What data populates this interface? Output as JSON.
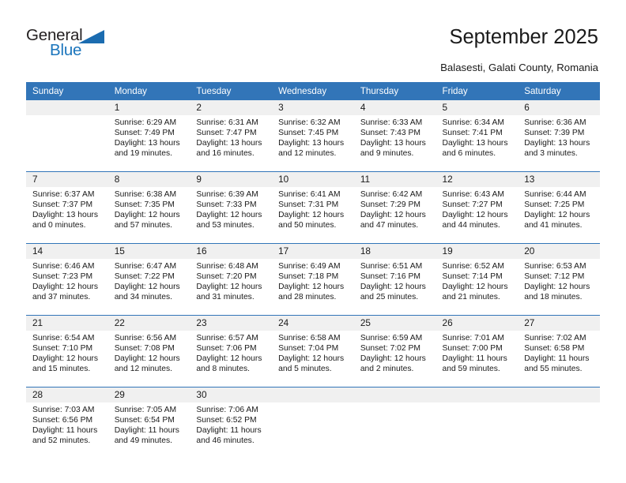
{
  "logo": {
    "word_one": "General",
    "word_two": "Blue",
    "triangle_color": "#1b6cb0",
    "blue_text_color": "#1b75bc"
  },
  "header": {
    "title": "September 2025",
    "subtitle": "Balasesti, Galati County, Romania",
    "accent_color": "#3275b8",
    "band_color": "#f0f0f0"
  },
  "calendar": {
    "weekday_headers": [
      "Sunday",
      "Monday",
      "Tuesday",
      "Wednesday",
      "Thursday",
      "Friday",
      "Saturday"
    ],
    "weeks": [
      [
        {
          "day": "",
          "sunrise": "",
          "sunset": "",
          "daylight_line1": "",
          "daylight_line2": ""
        },
        {
          "day": "1",
          "sunrise": "Sunrise: 6:29 AM",
          "sunset": "Sunset: 7:49 PM",
          "daylight_line1": "Daylight: 13 hours",
          "daylight_line2": "and 19 minutes."
        },
        {
          "day": "2",
          "sunrise": "Sunrise: 6:31 AM",
          "sunset": "Sunset: 7:47 PM",
          "daylight_line1": "Daylight: 13 hours",
          "daylight_line2": "and 16 minutes."
        },
        {
          "day": "3",
          "sunrise": "Sunrise: 6:32 AM",
          "sunset": "Sunset: 7:45 PM",
          "daylight_line1": "Daylight: 13 hours",
          "daylight_line2": "and 12 minutes."
        },
        {
          "day": "4",
          "sunrise": "Sunrise: 6:33 AM",
          "sunset": "Sunset: 7:43 PM",
          "daylight_line1": "Daylight: 13 hours",
          "daylight_line2": "and 9 minutes."
        },
        {
          "day": "5",
          "sunrise": "Sunrise: 6:34 AM",
          "sunset": "Sunset: 7:41 PM",
          "daylight_line1": "Daylight: 13 hours",
          "daylight_line2": "and 6 minutes."
        },
        {
          "day": "6",
          "sunrise": "Sunrise: 6:36 AM",
          "sunset": "Sunset: 7:39 PM",
          "daylight_line1": "Daylight: 13 hours",
          "daylight_line2": "and 3 minutes."
        }
      ],
      [
        {
          "day": "7",
          "sunrise": "Sunrise: 6:37 AM",
          "sunset": "Sunset: 7:37 PM",
          "daylight_line1": "Daylight: 13 hours",
          "daylight_line2": "and 0 minutes."
        },
        {
          "day": "8",
          "sunrise": "Sunrise: 6:38 AM",
          "sunset": "Sunset: 7:35 PM",
          "daylight_line1": "Daylight: 12 hours",
          "daylight_line2": "and 57 minutes."
        },
        {
          "day": "9",
          "sunrise": "Sunrise: 6:39 AM",
          "sunset": "Sunset: 7:33 PM",
          "daylight_line1": "Daylight: 12 hours",
          "daylight_line2": "and 53 minutes."
        },
        {
          "day": "10",
          "sunrise": "Sunrise: 6:41 AM",
          "sunset": "Sunset: 7:31 PM",
          "daylight_line1": "Daylight: 12 hours",
          "daylight_line2": "and 50 minutes."
        },
        {
          "day": "11",
          "sunrise": "Sunrise: 6:42 AM",
          "sunset": "Sunset: 7:29 PM",
          "daylight_line1": "Daylight: 12 hours",
          "daylight_line2": "and 47 minutes."
        },
        {
          "day": "12",
          "sunrise": "Sunrise: 6:43 AM",
          "sunset": "Sunset: 7:27 PM",
          "daylight_line1": "Daylight: 12 hours",
          "daylight_line2": "and 44 minutes."
        },
        {
          "day": "13",
          "sunrise": "Sunrise: 6:44 AM",
          "sunset": "Sunset: 7:25 PM",
          "daylight_line1": "Daylight: 12 hours",
          "daylight_line2": "and 41 minutes."
        }
      ],
      [
        {
          "day": "14",
          "sunrise": "Sunrise: 6:46 AM",
          "sunset": "Sunset: 7:23 PM",
          "daylight_line1": "Daylight: 12 hours",
          "daylight_line2": "and 37 minutes."
        },
        {
          "day": "15",
          "sunrise": "Sunrise: 6:47 AM",
          "sunset": "Sunset: 7:22 PM",
          "daylight_line1": "Daylight: 12 hours",
          "daylight_line2": "and 34 minutes."
        },
        {
          "day": "16",
          "sunrise": "Sunrise: 6:48 AM",
          "sunset": "Sunset: 7:20 PM",
          "daylight_line1": "Daylight: 12 hours",
          "daylight_line2": "and 31 minutes."
        },
        {
          "day": "17",
          "sunrise": "Sunrise: 6:49 AM",
          "sunset": "Sunset: 7:18 PM",
          "daylight_line1": "Daylight: 12 hours",
          "daylight_line2": "and 28 minutes."
        },
        {
          "day": "18",
          "sunrise": "Sunrise: 6:51 AM",
          "sunset": "Sunset: 7:16 PM",
          "daylight_line1": "Daylight: 12 hours",
          "daylight_line2": "and 25 minutes."
        },
        {
          "day": "19",
          "sunrise": "Sunrise: 6:52 AM",
          "sunset": "Sunset: 7:14 PM",
          "daylight_line1": "Daylight: 12 hours",
          "daylight_line2": "and 21 minutes."
        },
        {
          "day": "20",
          "sunrise": "Sunrise: 6:53 AM",
          "sunset": "Sunset: 7:12 PM",
          "daylight_line1": "Daylight: 12 hours",
          "daylight_line2": "and 18 minutes."
        }
      ],
      [
        {
          "day": "21",
          "sunrise": "Sunrise: 6:54 AM",
          "sunset": "Sunset: 7:10 PM",
          "daylight_line1": "Daylight: 12 hours",
          "daylight_line2": "and 15 minutes."
        },
        {
          "day": "22",
          "sunrise": "Sunrise: 6:56 AM",
          "sunset": "Sunset: 7:08 PM",
          "daylight_line1": "Daylight: 12 hours",
          "daylight_line2": "and 12 minutes."
        },
        {
          "day": "23",
          "sunrise": "Sunrise: 6:57 AM",
          "sunset": "Sunset: 7:06 PM",
          "daylight_line1": "Daylight: 12 hours",
          "daylight_line2": "and 8 minutes."
        },
        {
          "day": "24",
          "sunrise": "Sunrise: 6:58 AM",
          "sunset": "Sunset: 7:04 PM",
          "daylight_line1": "Daylight: 12 hours",
          "daylight_line2": "and 5 minutes."
        },
        {
          "day": "25",
          "sunrise": "Sunrise: 6:59 AM",
          "sunset": "Sunset: 7:02 PM",
          "daylight_line1": "Daylight: 12 hours",
          "daylight_line2": "and 2 minutes."
        },
        {
          "day": "26",
          "sunrise": "Sunrise: 7:01 AM",
          "sunset": "Sunset: 7:00 PM",
          "daylight_line1": "Daylight: 11 hours",
          "daylight_line2": "and 59 minutes."
        },
        {
          "day": "27",
          "sunrise": "Sunrise: 7:02 AM",
          "sunset": "Sunset: 6:58 PM",
          "daylight_line1": "Daylight: 11 hours",
          "daylight_line2": "and 55 minutes."
        }
      ],
      [
        {
          "day": "28",
          "sunrise": "Sunrise: 7:03 AM",
          "sunset": "Sunset: 6:56 PM",
          "daylight_line1": "Daylight: 11 hours",
          "daylight_line2": "and 52 minutes."
        },
        {
          "day": "29",
          "sunrise": "Sunrise: 7:05 AM",
          "sunset": "Sunset: 6:54 PM",
          "daylight_line1": "Daylight: 11 hours",
          "daylight_line2": "and 49 minutes."
        },
        {
          "day": "30",
          "sunrise": "Sunrise: 7:06 AM",
          "sunset": "Sunset: 6:52 PM",
          "daylight_line1": "Daylight: 11 hours",
          "daylight_line2": "and 46 minutes."
        },
        {
          "day": "",
          "sunrise": "",
          "sunset": "",
          "daylight_line1": "",
          "daylight_line2": ""
        },
        {
          "day": "",
          "sunrise": "",
          "sunset": "",
          "daylight_line1": "",
          "daylight_line2": ""
        },
        {
          "day": "",
          "sunrise": "",
          "sunset": "",
          "daylight_line1": "",
          "daylight_line2": ""
        },
        {
          "day": "",
          "sunrise": "",
          "sunset": "",
          "daylight_line1": "",
          "daylight_line2": ""
        }
      ]
    ]
  }
}
